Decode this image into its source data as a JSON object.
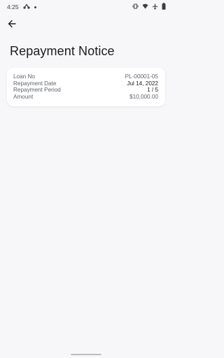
{
  "status_bar": {
    "time": "4:25"
  },
  "page": {
    "title": "Repayment Notice"
  },
  "details": [
    {
      "label": "Loan No",
      "value": "PL-00001-05",
      "emphasis": false
    },
    {
      "label": "Repayment Date",
      "value": "Jul 14, 2022",
      "emphasis": false
    },
    {
      "label": "Repayment Period",
      "value": "1 / 5",
      "emphasis": true
    },
    {
      "label": "Amount",
      "value": "$10,000.00",
      "emphasis": false
    }
  ],
  "icons": {
    "back": "arrow-left-icon",
    "status_left": [
      "notification-icon",
      "dot-icon"
    ],
    "status_right": [
      "vibrate-icon",
      "wifi-icon",
      "airplane-icon",
      "battery-icon"
    ]
  }
}
